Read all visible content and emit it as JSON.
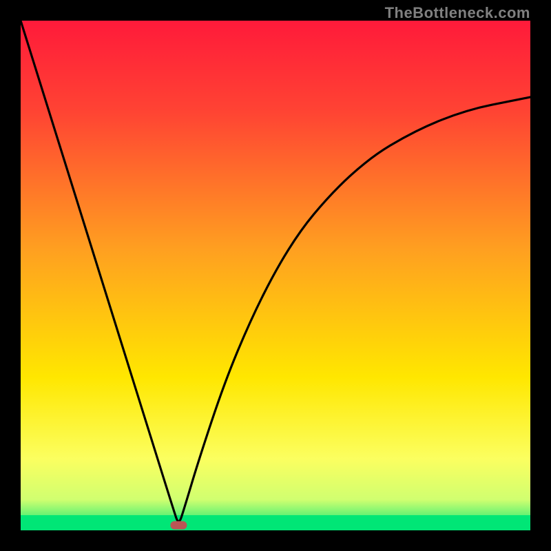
{
  "watermark": "TheBottleneck.com",
  "chart_data": {
    "type": "line",
    "title": "",
    "xlabel": "",
    "ylabel": "",
    "xlim": [
      0,
      100
    ],
    "ylim": [
      0,
      100
    ],
    "background_gradient": {
      "top": "#ff1a3a",
      "mid": "#ffd500",
      "bottom": "#00e676"
    },
    "green_band_y": [
      0,
      4
    ],
    "marker": {
      "x": 31,
      "y": 1,
      "color": "#bb5555",
      "shape": "rounded-rect"
    },
    "series": [
      {
        "name": "curve",
        "x": [
          0,
          5,
          10,
          15,
          20,
          25,
          30,
          31,
          32,
          35,
          40,
          45,
          50,
          55,
          60,
          65,
          70,
          75,
          80,
          85,
          90,
          95,
          100
        ],
        "y": [
          100,
          84,
          68,
          52,
          36,
          20,
          4,
          1,
          4,
          14,
          29,
          41,
          51,
          59,
          65,
          70,
          74,
          77,
          79.5,
          81.5,
          83,
          84,
          85
        ]
      }
    ]
  }
}
